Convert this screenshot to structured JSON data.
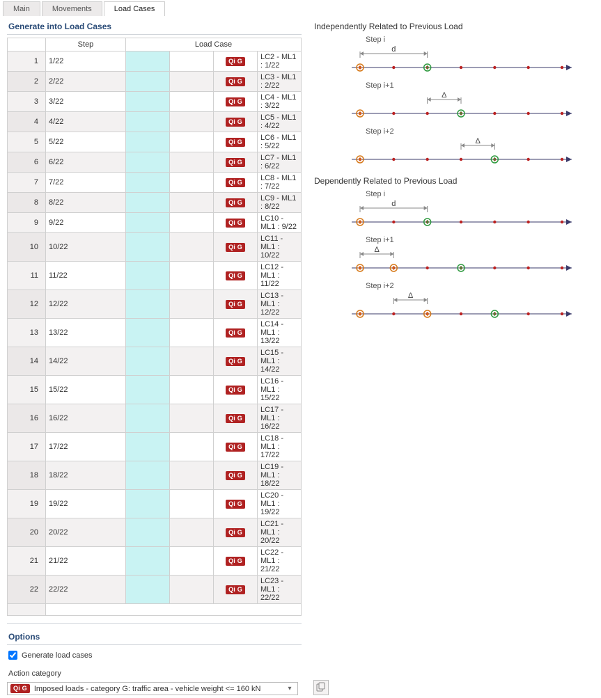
{
  "tabs": {
    "main": "Main",
    "movements": "Movements",
    "load_cases": "Load Cases"
  },
  "panel": {
    "generate_title": "Generate into Load Cases",
    "options_title": "Options",
    "gen_chk_label": "Generate load cases",
    "action_cat_label": "Action category",
    "qig_badge": "Qi G",
    "action_cat_value": "Imposed loads - category G: traffic area - vehicle weight <= 160 kN"
  },
  "headers": {
    "step": "Step",
    "loadcase": "Load Case"
  },
  "rows": [
    {
      "n": "1",
      "step": "1/22",
      "lc": "LC2 - ML1 : 1/22"
    },
    {
      "n": "2",
      "step": "2/22",
      "lc": "LC3 - ML1 : 2/22"
    },
    {
      "n": "3",
      "step": "3/22",
      "lc": "LC4 - ML1 : 3/22"
    },
    {
      "n": "4",
      "step": "4/22",
      "lc": "LC5 - ML1 : 4/22"
    },
    {
      "n": "5",
      "step": "5/22",
      "lc": "LC6 - ML1 : 5/22"
    },
    {
      "n": "6",
      "step": "6/22",
      "lc": "LC7 - ML1 : 6/22"
    },
    {
      "n": "7",
      "step": "7/22",
      "lc": "LC8 - ML1 : 7/22"
    },
    {
      "n": "8",
      "step": "8/22",
      "lc": "LC9 - ML1 : 8/22"
    },
    {
      "n": "9",
      "step": "9/22",
      "lc": "LC10 - ML1 : 9/22"
    },
    {
      "n": "10",
      "step": "10/22",
      "lc": "LC11 - ML1 : 10/22"
    },
    {
      "n": "11",
      "step": "11/22",
      "lc": "LC12 - ML1 : 11/22"
    },
    {
      "n": "12",
      "step": "12/22",
      "lc": "LC13 - ML1 : 12/22"
    },
    {
      "n": "13",
      "step": "13/22",
      "lc": "LC14 - ML1 : 13/22"
    },
    {
      "n": "14",
      "step": "14/22",
      "lc": "LC15 - ML1 : 14/22"
    },
    {
      "n": "15",
      "step": "15/22",
      "lc": "LC16 - ML1 : 15/22"
    },
    {
      "n": "16",
      "step": "16/22",
      "lc": "LC17 - ML1 : 16/22"
    },
    {
      "n": "17",
      "step": "17/22",
      "lc": "LC18 - ML1 : 17/22"
    },
    {
      "n": "18",
      "step": "18/22",
      "lc": "LC19 - ML1 : 18/22"
    },
    {
      "n": "19",
      "step": "19/22",
      "lc": "LC20 - ML1 : 19/22"
    },
    {
      "n": "20",
      "step": "20/22",
      "lc": "LC21 - ML1 : 20/22"
    },
    {
      "n": "21",
      "step": "21/22",
      "lc": "LC22 - ML1 : 21/22"
    },
    {
      "n": "22",
      "step": "22/22",
      "lc": "LC23 - ML1 : 22/22"
    }
  ],
  "right": {
    "indep_title": "Independently Related to Previous Load",
    "dep_title": "Dependently Related to Previous Load",
    "step_i": "Step i",
    "step_i1": "Step i+1",
    "step_i2": "Step i+2",
    "d": "d",
    "delta": "Δ"
  },
  "chart_data": [
    {
      "type": "diagram-line",
      "title": "Independently Related to Previous Load",
      "steps": [
        {
          "label": "Step i",
          "dim_label": "d",
          "start": 0,
          "dim_start": 0,
          "dim_end": 2,
          "highlight": 2,
          "extra": null
        },
        {
          "label": "Step i+1",
          "dim_label": "Δ",
          "start": 0,
          "dim_start": 2,
          "dim_end": 3,
          "highlight": 3,
          "extra": null
        },
        {
          "label": "Step i+2",
          "dim_label": "Δ",
          "start": 0,
          "dim_start": 3,
          "dim_end": 4,
          "highlight": 4,
          "extra": null
        }
      ],
      "ticks": 7
    },
    {
      "type": "diagram-line",
      "title": "Dependently Related to Previous Load",
      "steps": [
        {
          "label": "Step i",
          "dim_label": "d",
          "start": 0,
          "dim_start": 0,
          "dim_end": 2,
          "highlight": 2,
          "extra": null
        },
        {
          "label": "Step i+1",
          "dim_label": "Δ",
          "start": 0,
          "dim_start": 0,
          "dim_end": 1,
          "highlight": 3,
          "extra": 1
        },
        {
          "label": "Step i+2",
          "dim_label": "Δ",
          "start": 0,
          "dim_start": 1,
          "dim_end": 2,
          "highlight": 4,
          "extra": 2
        }
      ],
      "ticks": 7
    }
  ]
}
